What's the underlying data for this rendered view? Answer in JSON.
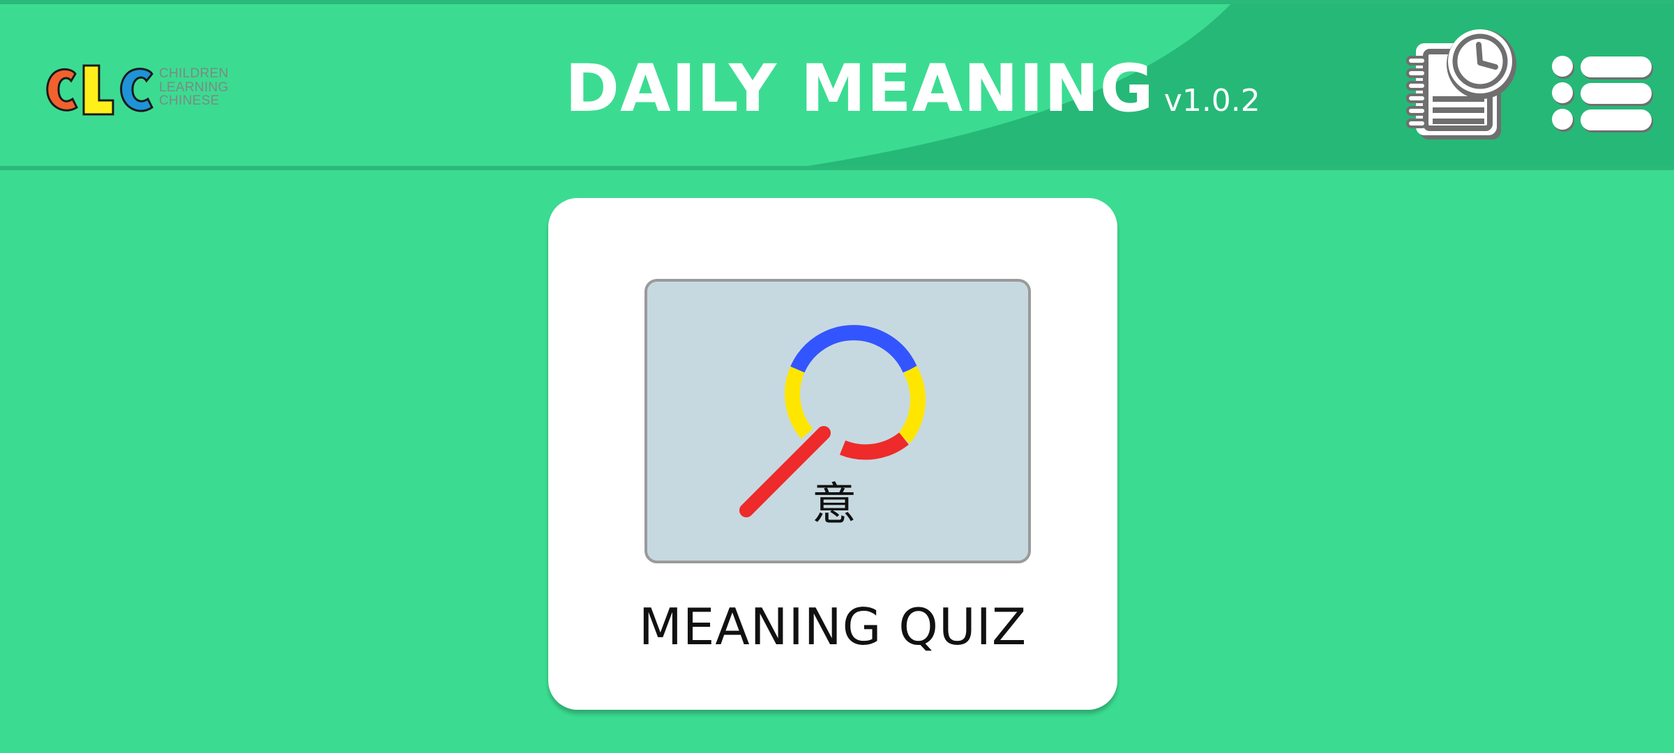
{
  "header": {
    "logo": {
      "letters": "CLC",
      "lines": [
        "CHILDREN",
        "LEARNING",
        "CHINESE"
      ]
    },
    "title": "DAILY MEANING",
    "version": "v1.0.2",
    "icons": {
      "history": "notebook-clock-icon",
      "menu": "list-menu-icon"
    }
  },
  "quiz_card": {
    "label": "MEANING QUIZ",
    "thumbnail_char": "意",
    "thumbnail_icon": "magnifying-glass-icon"
  },
  "colors": {
    "background": "#3bdc91",
    "header_dark": "#26b877",
    "card": "#ffffff",
    "thumb_bg": "#c7d9e0",
    "blue": "#3355ff",
    "yellow": "#ffe600",
    "red": "#ee2a2a"
  }
}
